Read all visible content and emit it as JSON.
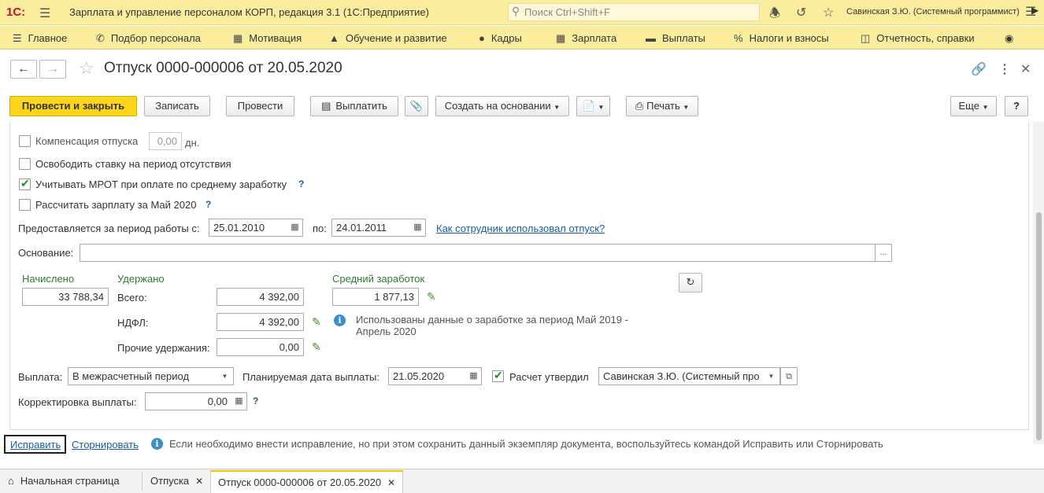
{
  "titlebar": {
    "logo": "1С:",
    "title": "Зарплата и управление персоналом КОРП, редакция 3.1   (1С:Предприятие)",
    "search_placeholder": "Поиск Ctrl+Shift+F",
    "user": "Савинская З.Ю. (Системный программист)"
  },
  "menu": [
    {
      "icon": "home-icon",
      "label": "Главное"
    },
    {
      "icon": "phone-icon",
      "label": "Подбор персонала"
    },
    {
      "icon": "gift-icon",
      "label": "Мотивация"
    },
    {
      "icon": "graduation-icon",
      "label": "Обучение и развитие"
    },
    {
      "icon": "people-icon",
      "label": "Кадры"
    },
    {
      "icon": "calculator-icon",
      "label": "Зарплата"
    },
    {
      "icon": "wallet-icon",
      "label": "Выплаты"
    },
    {
      "icon": "percent-icon",
      "label": "Налоги и взносы"
    },
    {
      "icon": "reports-icon",
      "label": "Отчетность, справки"
    }
  ],
  "document": {
    "title": "Отпуск 0000-000006 от 20.05.2020"
  },
  "toolbar": {
    "post_close": "Провести и закрыть",
    "save": "Записать",
    "post": "Провести",
    "pay": "Выплатить",
    "create_based": "Создать на основании",
    "print": "Печать",
    "more": "Еще",
    "help": "?"
  },
  "form": {
    "compensation_label": "Компенсация отпуска",
    "compensation_value": "0,00",
    "compensation_unit": "дн.",
    "free_rate_label": "Освободить ставку на период отсутствия",
    "mrot_label": "Учитывать МРОТ при оплате по среднему заработку",
    "calc_salary_label": "Рассчитать зарплату за Май 2020",
    "period_label": "Предоставляется за период работы с:",
    "period_from": "25.01.2010",
    "period_to_label": "по:",
    "period_to": "24.01.2011",
    "how_used_link": "Как сотрудник использовал отпуск?",
    "basis_label": "Основание:",
    "basis_value": "",
    "accrued_label": "Начислено",
    "accrued_value": "33 788,34",
    "withheld_label": "Удержано",
    "total_label": "Всего:",
    "total_value": "4 392,00",
    "ndfl_label": "НДФЛ:",
    "ndfl_value": "4 392,00",
    "other_label": "Прочие удержания:",
    "other_value": "0,00",
    "avg_label": "Средний заработок",
    "avg_value": "1 877,13",
    "avg_info": "Использованы данные о заработке за период Май 2019 - Апрель 2020",
    "payout_label": "Выплата:",
    "payout_value": "В межрасчетный период",
    "planned_date_label": "Планируемая дата выплаты:",
    "planned_date": "21.05.2020",
    "approved_label": "Расчет утвердил",
    "approved_value": "Савинская З.Ю. (Системный про",
    "correction_label": "Корректировка выплаты:",
    "correction_value": "0,00"
  },
  "bottom": {
    "fix_link": "Исправить",
    "storno_link": "Сторнировать",
    "hint": "Если необходимо внести исправление, но при этом сохранить данный экземпляр документа, воспользуйтесь командой Исправить или Сторнировать"
  },
  "tabs": [
    {
      "label": "Начальная страница"
    },
    {
      "label": "Отпуска"
    },
    {
      "label": "Отпуск 0000-000006 от 20.05.2020"
    }
  ]
}
